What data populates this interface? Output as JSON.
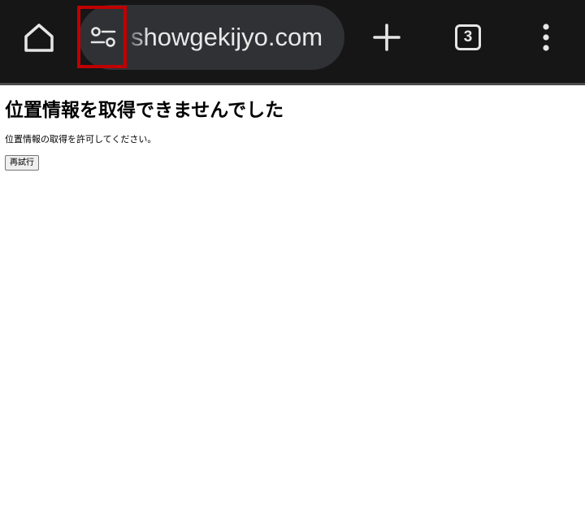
{
  "browser": {
    "url": "showgekijyo.com",
    "tab_count": "3",
    "icons": {
      "home": "home-icon",
      "site_settings": "tune-icon",
      "new_tab": "plus-icon",
      "menu": "more-vertical-icon"
    },
    "colors": {
      "toolbar_bg": "#161616",
      "url_pill_bg": "#303134",
      "highlight": "#c00000"
    }
  },
  "page": {
    "title": "位置情報を取得できませんでした",
    "message": "位置情報の取得を許可してください。",
    "retry_label": "再試行"
  }
}
